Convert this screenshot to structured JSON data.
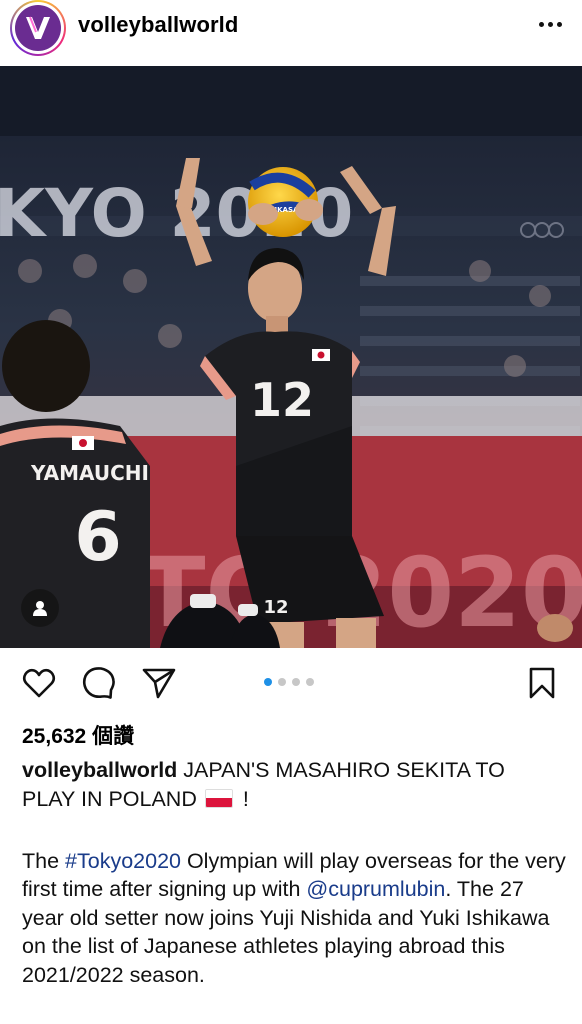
{
  "header": {
    "username": "volleyballworld",
    "avatar_icon": "volleyball-world-logo-icon",
    "more_icon": "more-dots-icon"
  },
  "post": {
    "image": {
      "backdrop_text_left": "KYO 2020",
      "backdrop_text_bottom": "TO 2020",
      "ball_print": "MIKASA",
      "left_player_name": "YAMAUCHI",
      "left_player_number": "6",
      "setter_number": "12",
      "setter_shorts_number": "12"
    },
    "user_tag_icon": "person-icon",
    "carousel": {
      "total": 4,
      "active_index": 0
    },
    "actions": {
      "like_icon": "heart-icon",
      "comment_icon": "comment-bubble-icon",
      "share_icon": "paper-plane-icon",
      "save_icon": "bookmark-icon"
    },
    "likes_label": "25,632 個讚",
    "caption": {
      "username": "volleyballworld",
      "headline_before_flag": " JAPAN'S MASAHIRO SEKITA TO PLAY IN POLAND",
      "headline_after_flag": " !",
      "flag_icon": "poland-flag-icon"
    },
    "body": {
      "part1": "The ",
      "hashtag": "#Tokyo2020",
      "part2": " Olympian will play overseas for the very first time after signing up with ",
      "mention": "@cuprumlubin",
      "part3": ". The 27 year old setter now joins Yuji Nishida and Yuki Ishikawa on the list of Japanese athletes playing abroad this 2021/2022 season."
    }
  },
  "colors": {
    "link": "#1a3c8a",
    "carousel_active": "#1e90e6",
    "carousel_inactive": "#c7c7c7",
    "avatar_purple": "#6a2c91"
  }
}
